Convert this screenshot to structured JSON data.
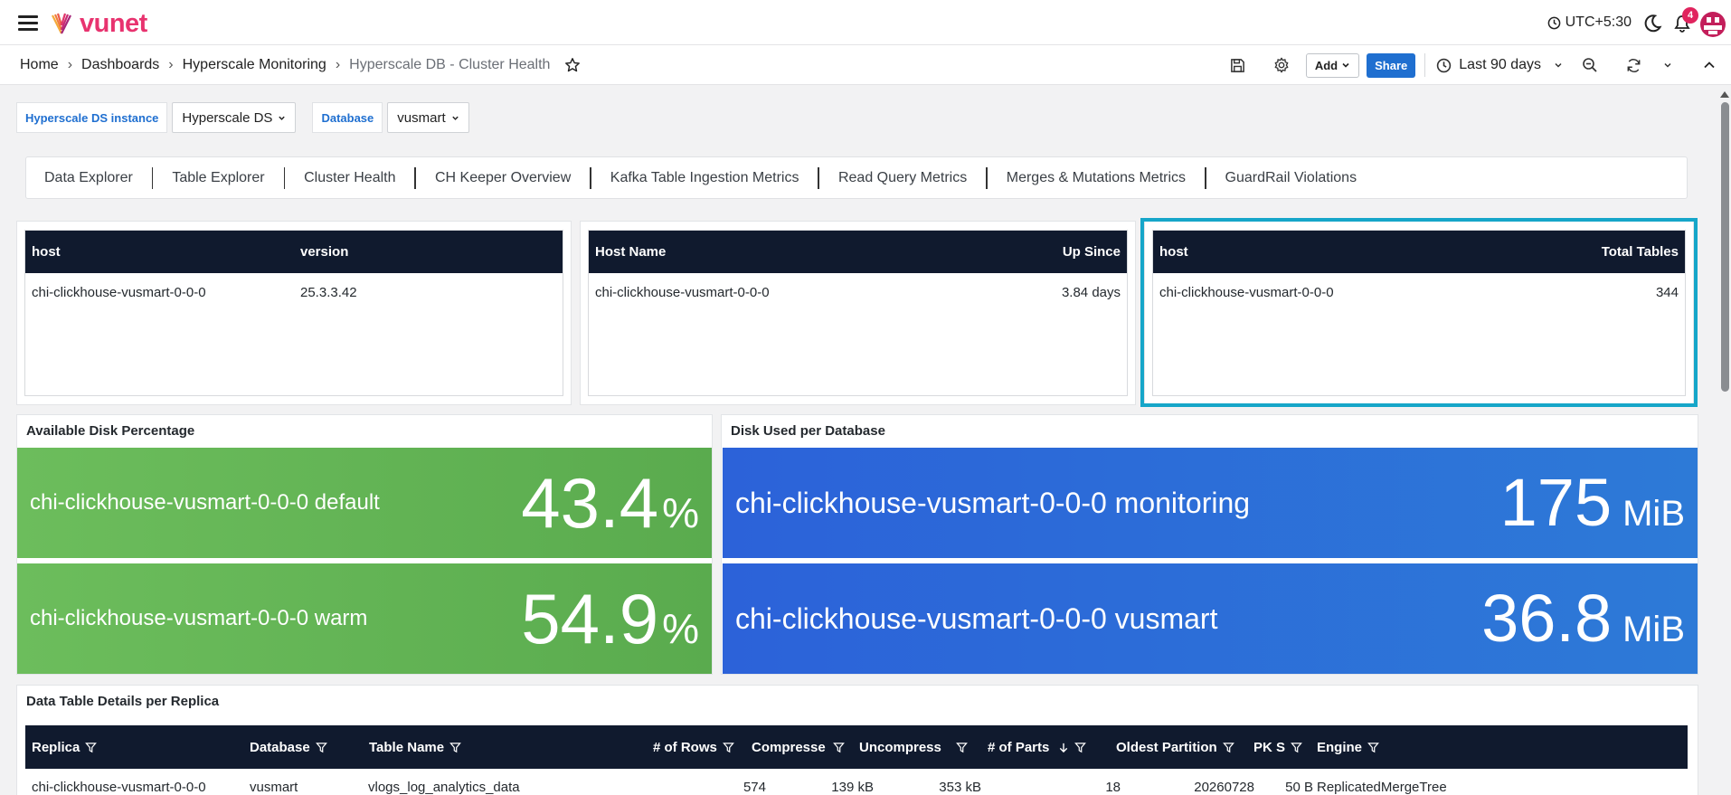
{
  "topbar": {
    "logo_text": "vunet",
    "timezone": "UTC+5:30",
    "notification_count": "4"
  },
  "breadcrumb": {
    "items": [
      "Home",
      "Dashboards",
      "Hyperscale Monitoring",
      "Hyperscale DB - Cluster Health"
    ]
  },
  "toolbar": {
    "add_label": "Add",
    "share_label": "Share",
    "time_range": "Last 90 days"
  },
  "variables": {
    "ds_label": "Hyperscale DS instance",
    "ds_value": "Hyperscale DS",
    "db_label": "Database",
    "db_value": "vusmart"
  },
  "tabs": [
    "Data Explorer",
    "Table Explorer",
    "Cluster Health",
    "CH Keeper Overview",
    "Kafka Table Ingestion Metrics",
    "Read Query Metrics",
    "Merges & Mutations Metrics",
    "GuardRail Violations"
  ],
  "version_table": {
    "headers": [
      "host",
      "version"
    ],
    "row": [
      "chi-clickhouse-vusmart-0-0-0",
      "25.3.3.42"
    ]
  },
  "uptime_table": {
    "headers": [
      "Host Name",
      "Up Since"
    ],
    "row": [
      "chi-clickhouse-vusmart-0-0-0",
      "3.84 days"
    ]
  },
  "tables_table": {
    "headers": [
      "host",
      "Total Tables"
    ],
    "row": [
      "chi-clickhouse-vusmart-0-0-0",
      "344"
    ]
  },
  "disk_available": {
    "title": "Available Disk Percentage",
    "items": [
      {
        "name": "chi-clickhouse-vusmart-0-0-0 default",
        "value": "43.4",
        "unit": "%"
      },
      {
        "name": "chi-clickhouse-vusmart-0-0-0 warm",
        "value": "54.9",
        "unit": "%"
      }
    ],
    "color": "#65b657"
  },
  "disk_used": {
    "title": "Disk Used per Database",
    "items": [
      {
        "name": "chi-clickhouse-vusmart-0-0-0 monitoring",
        "value": "175",
        "unit": "MiB"
      },
      {
        "name": "chi-clickhouse-vusmart-0-0-0 vusmart",
        "value": "36.8",
        "unit": "MiB"
      }
    ],
    "color": "#2d6ad8"
  },
  "details": {
    "title": "Data Table Details per Replica",
    "columns": [
      "Replica",
      "Database",
      "Table Name",
      "# of Rows",
      "Compresse",
      "Uncompress",
      "# of Parts",
      "Oldest Partition",
      "PK S",
      "Engine"
    ],
    "rows": [
      [
        "chi-clickhouse-vusmart-0-0-0",
        "vusmart",
        "vlogs_log_analytics_data",
        "574",
        "139 kB",
        "353 kB",
        "18",
        "20260728",
        "50 B",
        "ReplicatedMergeTree"
      ]
    ]
  }
}
